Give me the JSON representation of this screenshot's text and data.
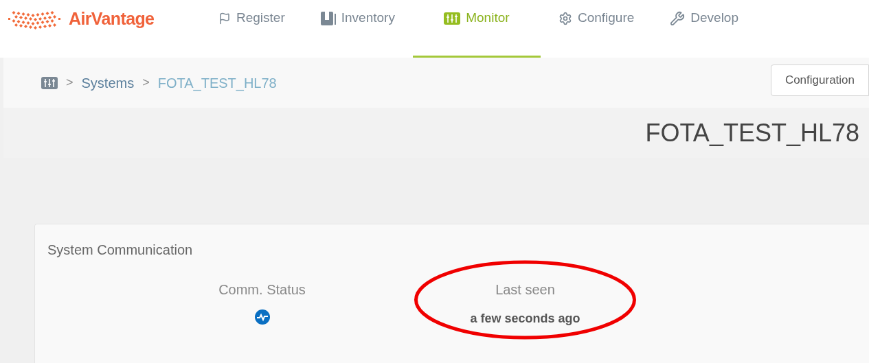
{
  "brand": {
    "name": "AirVantage"
  },
  "nav": [
    {
      "label": "Register",
      "selected": false
    },
    {
      "label": "Inventory",
      "selected": false
    },
    {
      "label": "Monitor",
      "selected": true
    },
    {
      "label": "Configure",
      "selected": false
    },
    {
      "label": "Develop",
      "selected": false
    }
  ],
  "breadcrumb": [
    {
      "label": "Systems",
      "current": false
    },
    {
      "label": "FOTA_TEST_HL78",
      "current": true
    }
  ],
  "breadcrumb_separator": ">",
  "action_button": "Configuration",
  "page_title": "FOTA_TEST_HL78",
  "card": {
    "title": "System Communication",
    "fields": [
      {
        "label": "Comm. Status",
        "kind": "icon",
        "highlighted": false
      },
      {
        "label": "Last seen",
        "kind": "text",
        "value": "a few seconds ago",
        "highlighted": true
      }
    ]
  }
}
